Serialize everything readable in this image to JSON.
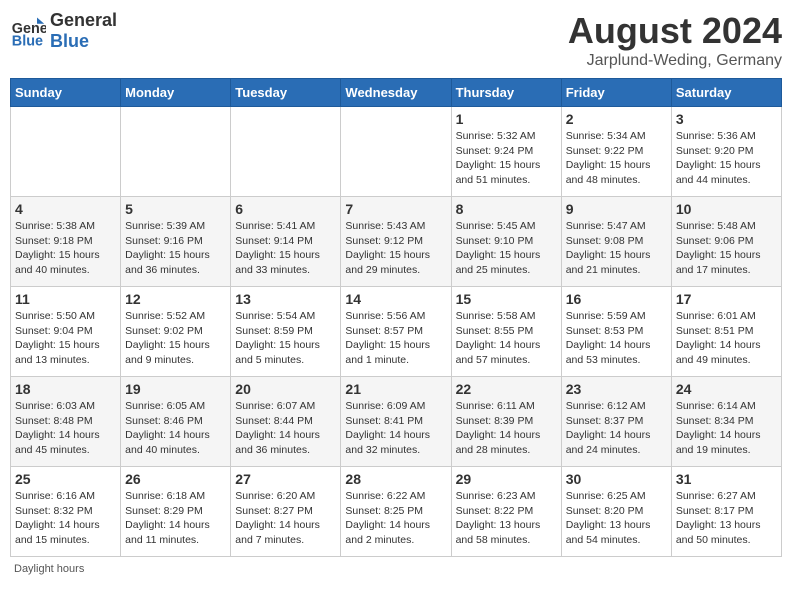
{
  "header": {
    "logo_general": "General",
    "logo_blue": "Blue",
    "month_year": "August 2024",
    "location": "Jarplund-Weding, Germany"
  },
  "weekdays": [
    "Sunday",
    "Monday",
    "Tuesday",
    "Wednesday",
    "Thursday",
    "Friday",
    "Saturday"
  ],
  "footer": {
    "daylight_label": "Daylight hours"
  },
  "weeks": [
    [
      {
        "day": "",
        "info": ""
      },
      {
        "day": "",
        "info": ""
      },
      {
        "day": "",
        "info": ""
      },
      {
        "day": "",
        "info": ""
      },
      {
        "day": "1",
        "info": "Sunrise: 5:32 AM\nSunset: 9:24 PM\nDaylight: 15 hours and 51 minutes."
      },
      {
        "day": "2",
        "info": "Sunrise: 5:34 AM\nSunset: 9:22 PM\nDaylight: 15 hours and 48 minutes."
      },
      {
        "day": "3",
        "info": "Sunrise: 5:36 AM\nSunset: 9:20 PM\nDaylight: 15 hours and 44 minutes."
      }
    ],
    [
      {
        "day": "4",
        "info": "Sunrise: 5:38 AM\nSunset: 9:18 PM\nDaylight: 15 hours and 40 minutes."
      },
      {
        "day": "5",
        "info": "Sunrise: 5:39 AM\nSunset: 9:16 PM\nDaylight: 15 hours and 36 minutes."
      },
      {
        "day": "6",
        "info": "Sunrise: 5:41 AM\nSunset: 9:14 PM\nDaylight: 15 hours and 33 minutes."
      },
      {
        "day": "7",
        "info": "Sunrise: 5:43 AM\nSunset: 9:12 PM\nDaylight: 15 hours and 29 minutes."
      },
      {
        "day": "8",
        "info": "Sunrise: 5:45 AM\nSunset: 9:10 PM\nDaylight: 15 hours and 25 minutes."
      },
      {
        "day": "9",
        "info": "Sunrise: 5:47 AM\nSunset: 9:08 PM\nDaylight: 15 hours and 21 minutes."
      },
      {
        "day": "10",
        "info": "Sunrise: 5:48 AM\nSunset: 9:06 PM\nDaylight: 15 hours and 17 minutes."
      }
    ],
    [
      {
        "day": "11",
        "info": "Sunrise: 5:50 AM\nSunset: 9:04 PM\nDaylight: 15 hours and 13 minutes."
      },
      {
        "day": "12",
        "info": "Sunrise: 5:52 AM\nSunset: 9:02 PM\nDaylight: 15 hours and 9 minutes."
      },
      {
        "day": "13",
        "info": "Sunrise: 5:54 AM\nSunset: 8:59 PM\nDaylight: 15 hours and 5 minutes."
      },
      {
        "day": "14",
        "info": "Sunrise: 5:56 AM\nSunset: 8:57 PM\nDaylight: 15 hours and 1 minute."
      },
      {
        "day": "15",
        "info": "Sunrise: 5:58 AM\nSunset: 8:55 PM\nDaylight: 14 hours and 57 minutes."
      },
      {
        "day": "16",
        "info": "Sunrise: 5:59 AM\nSunset: 8:53 PM\nDaylight: 14 hours and 53 minutes."
      },
      {
        "day": "17",
        "info": "Sunrise: 6:01 AM\nSunset: 8:51 PM\nDaylight: 14 hours and 49 minutes."
      }
    ],
    [
      {
        "day": "18",
        "info": "Sunrise: 6:03 AM\nSunset: 8:48 PM\nDaylight: 14 hours and 45 minutes."
      },
      {
        "day": "19",
        "info": "Sunrise: 6:05 AM\nSunset: 8:46 PM\nDaylight: 14 hours and 40 minutes."
      },
      {
        "day": "20",
        "info": "Sunrise: 6:07 AM\nSunset: 8:44 PM\nDaylight: 14 hours and 36 minutes."
      },
      {
        "day": "21",
        "info": "Sunrise: 6:09 AM\nSunset: 8:41 PM\nDaylight: 14 hours and 32 minutes."
      },
      {
        "day": "22",
        "info": "Sunrise: 6:11 AM\nSunset: 8:39 PM\nDaylight: 14 hours and 28 minutes."
      },
      {
        "day": "23",
        "info": "Sunrise: 6:12 AM\nSunset: 8:37 PM\nDaylight: 14 hours and 24 minutes."
      },
      {
        "day": "24",
        "info": "Sunrise: 6:14 AM\nSunset: 8:34 PM\nDaylight: 14 hours and 19 minutes."
      }
    ],
    [
      {
        "day": "25",
        "info": "Sunrise: 6:16 AM\nSunset: 8:32 PM\nDaylight: 14 hours and 15 minutes."
      },
      {
        "day": "26",
        "info": "Sunrise: 6:18 AM\nSunset: 8:29 PM\nDaylight: 14 hours and 11 minutes."
      },
      {
        "day": "27",
        "info": "Sunrise: 6:20 AM\nSunset: 8:27 PM\nDaylight: 14 hours and 7 minutes."
      },
      {
        "day": "28",
        "info": "Sunrise: 6:22 AM\nSunset: 8:25 PM\nDaylight: 14 hours and 2 minutes."
      },
      {
        "day": "29",
        "info": "Sunrise: 6:23 AM\nSunset: 8:22 PM\nDaylight: 13 hours and 58 minutes."
      },
      {
        "day": "30",
        "info": "Sunrise: 6:25 AM\nSunset: 8:20 PM\nDaylight: 13 hours and 54 minutes."
      },
      {
        "day": "31",
        "info": "Sunrise: 6:27 AM\nSunset: 8:17 PM\nDaylight: 13 hours and 50 minutes."
      }
    ]
  ]
}
